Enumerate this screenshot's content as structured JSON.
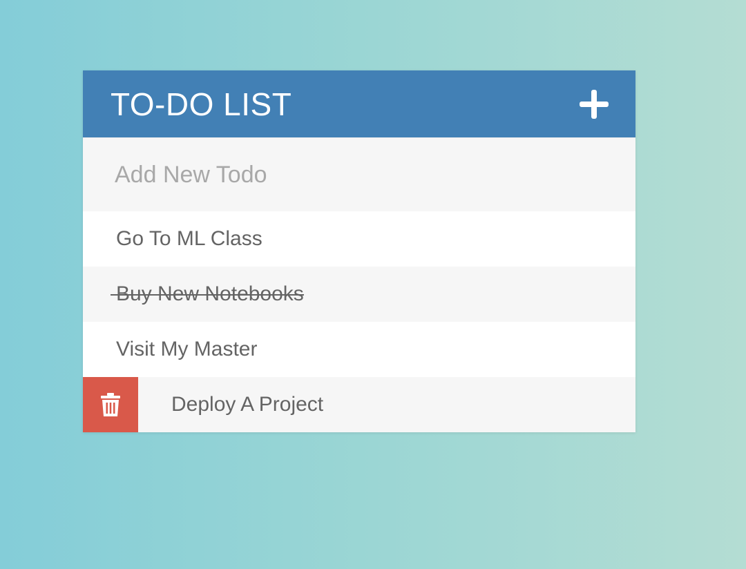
{
  "header": {
    "title": "TO-DO LIST",
    "add_icon": "plus-icon"
  },
  "new_todo": {
    "placeholder": "Add New Todo",
    "value": ""
  },
  "todos": [
    {
      "label": "Go To ML Class",
      "done": false
    },
    {
      "label": "Buy New Notebooks",
      "done": true
    },
    {
      "label": "Visit My Master",
      "done": false
    },
    {
      "label": "Deploy A Project",
      "done": false,
      "delete_visible": true
    }
  ],
  "icons": {
    "delete": "trash-icon"
  },
  "colors": {
    "header": "#4280b5",
    "delete": "#d9594a",
    "text": "#646464",
    "placeholder": "#a8a8a8",
    "row_alt": "#f6f6f6"
  }
}
